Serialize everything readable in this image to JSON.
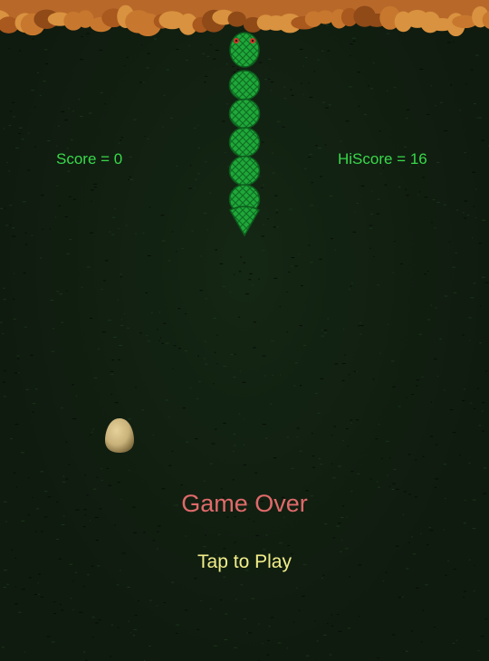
{
  "hud": {
    "score_text": "Score = 0",
    "hiscore_text": "HiScore = 16",
    "score": 0,
    "hiscore": 16
  },
  "overlay": {
    "game_over_text": "Game Over",
    "tap_to_play_text": "Tap to Play"
  },
  "snake": {
    "body_segments": 5,
    "direction": "up"
  },
  "items": {
    "food": "egg-icon"
  },
  "colors": {
    "background": "#0f1b0f",
    "hud_text": "#39d84a",
    "game_over": "#e06a6a",
    "tap_to_play": "#f2ee8a",
    "snake_green": "#1fa83a",
    "rock_orange": "#c8782e",
    "egg": "#c9b27a"
  }
}
